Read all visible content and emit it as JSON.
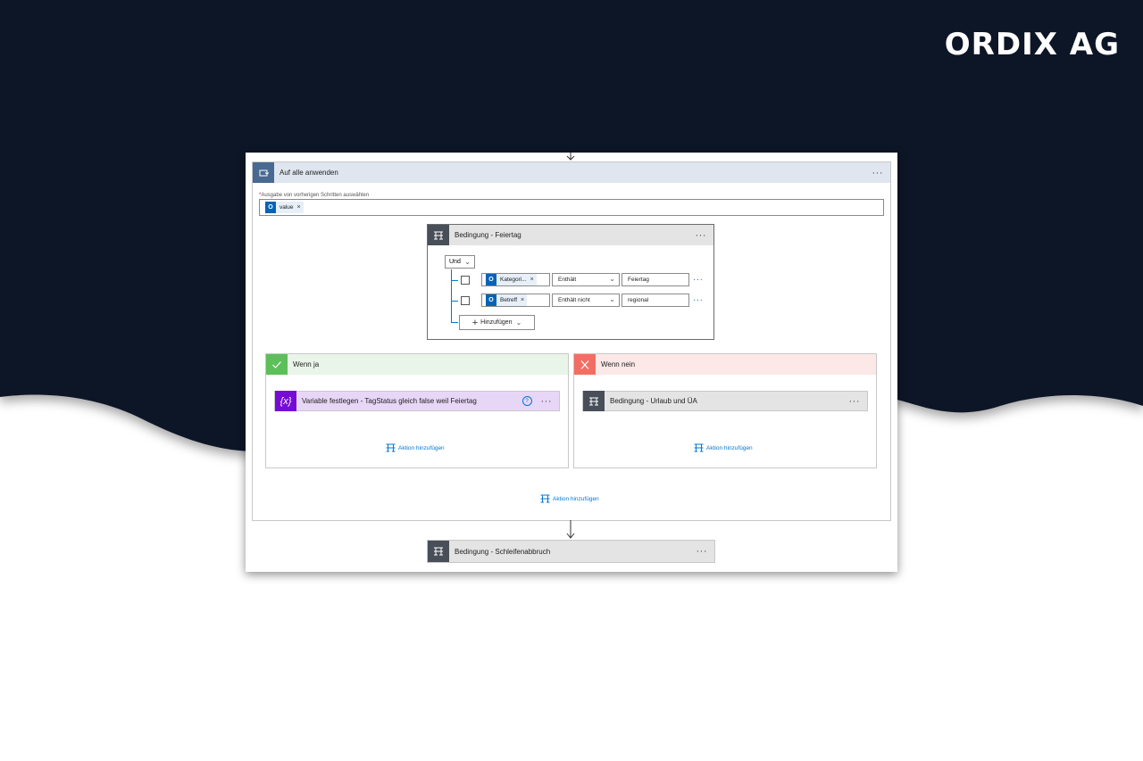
{
  "brand": {
    "logo_text": "ORDIX AG",
    "navy": "#0c1528",
    "white": "#ffffff"
  },
  "loop": {
    "title": "Auf alle anwenden",
    "icon": "loop-icon",
    "field_label": "Ausgabe von vorherigen Schritten auswählen",
    "required_marker": "*",
    "token": {
      "icon": "outlook-icon",
      "label": "value"
    }
  },
  "condition_feiertag": {
    "title": "Bedingung - Feiertag",
    "icon": "condition-icon",
    "group_operator": "Und",
    "rows": [
      {
        "token": "Kategori...",
        "operator": "Enthält",
        "value": "Feiertag"
      },
      {
        "token": "Betreff",
        "operator": "Enthält nicht",
        "value": "regional"
      }
    ],
    "add_label": "Hinzufügen"
  },
  "branch_yes": {
    "title": "Wenn ja",
    "action": {
      "title": "Variable festlegen - TagStatus gleich false weil Feiertag",
      "icon": "variable-icon",
      "icon_glyph": "{x}"
    },
    "add_action_label": "Aktion hinzufügen"
  },
  "branch_no": {
    "title": "Wenn nein",
    "action": {
      "title": "Bedingung - Urlaub und ÜA",
      "icon": "condition-icon"
    },
    "add_action_label": "Aktion hinzufügen"
  },
  "loop_add_action_label": "Aktion hinzufügen",
  "condition_schleife": {
    "title": "Bedingung - Schleifenabbruch",
    "icon": "condition-icon"
  },
  "colors": {
    "loop_icon": "#486991",
    "condition_icon": "#484f58",
    "variable_icon": "#770bd6",
    "yes": "#5cbf5a",
    "no": "#f26e63",
    "link": "#0078d4"
  }
}
